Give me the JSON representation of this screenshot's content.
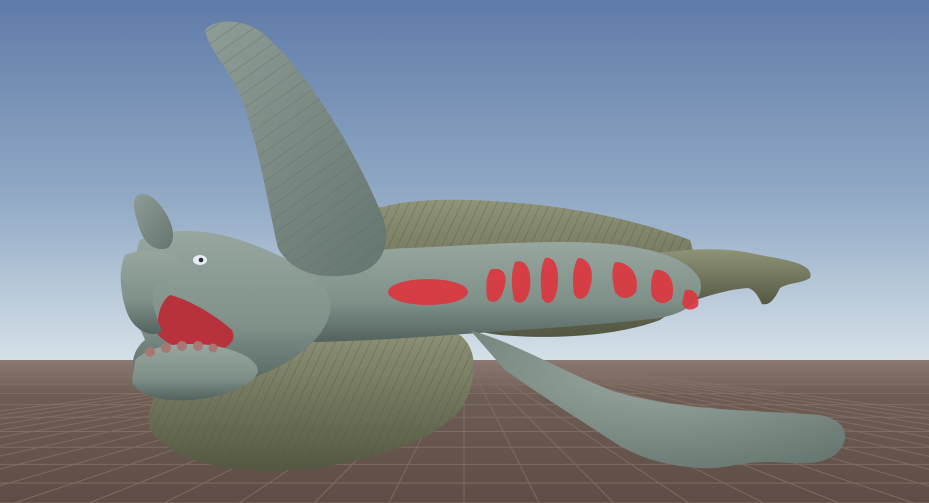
{
  "scene": {
    "sky_top_color": "#5f7ba8",
    "sky_horizon_color": "#d9e3ea",
    "ground_color": "#6e5d55",
    "grid_line_color": "#857269",
    "creature": {
      "skin_color": "#7f9089",
      "skin_shadow_color": "#53625e",
      "fur_color": "#7d8267",
      "fur_shadow_color": "#545842",
      "marking_color": "#e0323a",
      "mouth_color": "#b8323c"
    }
  }
}
